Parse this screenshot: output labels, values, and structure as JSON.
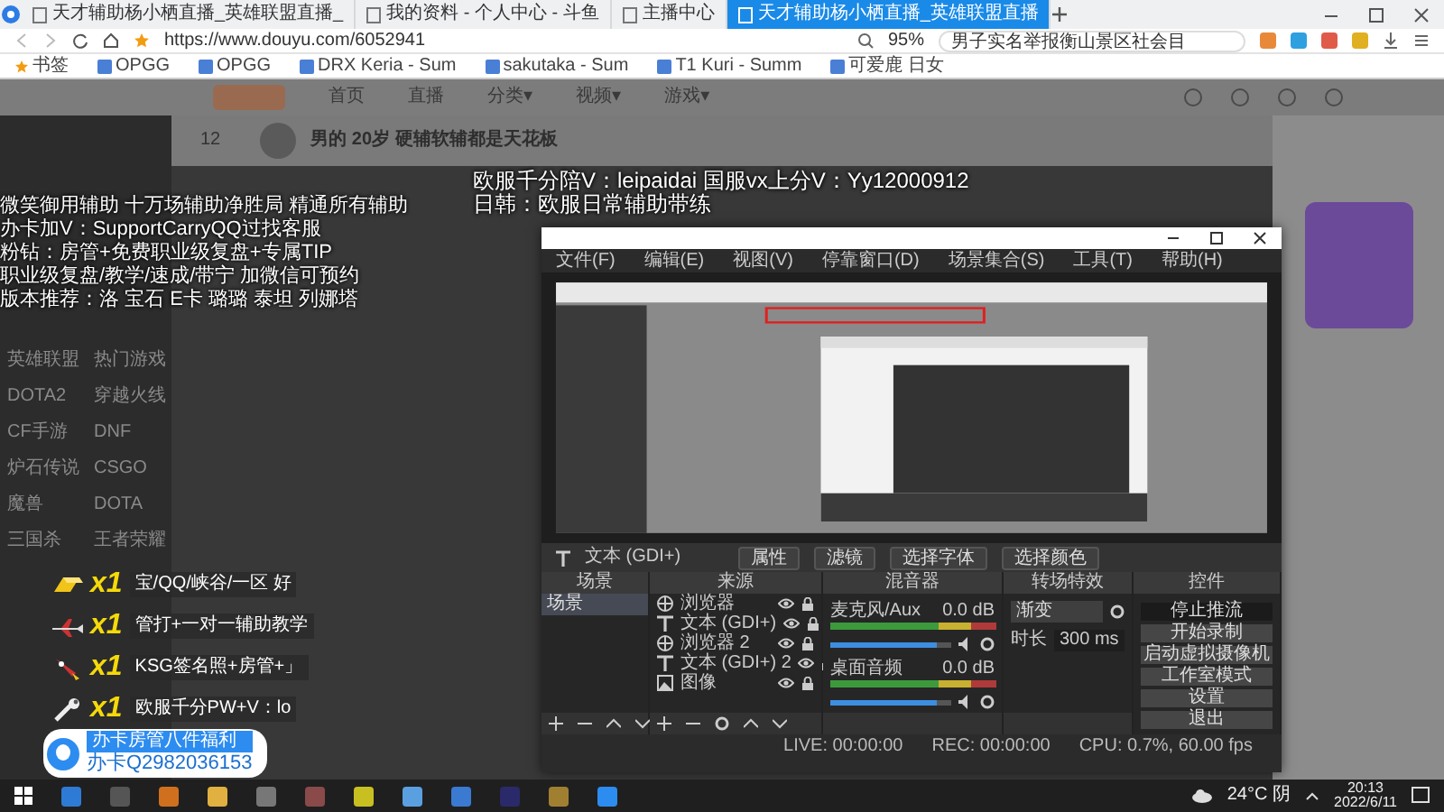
{
  "browser": {
    "tabs": [
      {
        "title": "天才辅助杨小栖直播_英雄联盟直播_",
        "selected": false
      },
      {
        "title": "我的资料 - 个人中心 - 斗鱼",
        "selected": false
      },
      {
        "title": "主播中心",
        "selected": false
      },
      {
        "title": "天才辅助杨小栖直播_英雄联盟直播",
        "selected": true
      }
    ],
    "url": "https://www.douyu.com/6052941",
    "zoom": "95%",
    "search": "男子实名举报衡山景区社会目",
    "bookmarks": [
      "书签",
      "OPGG",
      "OPGG",
      "DRX Keria - Sum",
      "sakutaka - Sum",
      "T1 Kuri - Summ",
      "可爱鹿 日女"
    ]
  },
  "page": {
    "nav": [
      "首页",
      "直播",
      "分类▾",
      "视频▾",
      "游戏▾"
    ],
    "sidebar_categories": [
      "英雄联盟",
      "热门游戏",
      "DOTA2",
      "穿越火线",
      "CF手游",
      "DNF",
      "炉石传说",
      "CSGO",
      "魔兽",
      "DOTA",
      "三国杀",
      "王者荣耀"
    ],
    "streamer": {
      "title": "男的 20岁 硬辅软辅都是天花板",
      "stat": "12"
    }
  },
  "overlay": {
    "banner": [
      "欧服千分陪V：leipaidai 国服vx上分V：Yy12000912",
      "日韩：欧服日常辅助带练"
    ],
    "notes": [
      "微笑御用辅助 十万场辅助净胜局 精通所有辅助",
      "办卡加V：SupportCarryQQ过找客服",
      "粉钻：房管+免费职业级复盘+专属TIP",
      "职业级复盘/教学/速成/带宁 加微信可预约",
      "版本推荐：洛 宝石 E卡 璐璐 泰坦 列娜塔"
    ],
    "gifts": [
      {
        "kind": "bar",
        "count": "x1",
        "text": "宝/QQ/峡谷/一区 好"
      },
      {
        "kind": "plane",
        "count": "x1",
        "text": "管打+一对一辅助教学"
      },
      {
        "kind": "rocket",
        "count": "x1",
        "text": "KSG签名照+房管+」"
      },
      {
        "kind": "wrench",
        "count": "x1",
        "text": "欧服千分PW+V：lo"
      }
    ],
    "qq_card": {
      "label": "办卡房管八件福利",
      "number": "办卡Q2982036153"
    }
  },
  "obs": {
    "menu": [
      "文件(F)",
      "编辑(E)",
      "视图(V)",
      "停靠窗口(D)",
      "场景集合(S)",
      "工具(T)",
      "帮助(H)"
    ],
    "source_name": "文本 (GDI+)",
    "toolbar_buttons": [
      "属性",
      "滤镜",
      "选择字体",
      "选择颜色"
    ],
    "docks": [
      "场景",
      "来源",
      "混音器",
      "转场特效",
      "控件"
    ],
    "scenes": [
      {
        "name": "场景",
        "selected": true
      }
    ],
    "sources": [
      {
        "kind": "browser",
        "name": "浏览器"
      },
      {
        "kind": "text",
        "name": "文本 (GDI+)"
      },
      {
        "kind": "browser",
        "name": "浏览器 2"
      },
      {
        "kind": "text",
        "name": "文本 (GDI+) 2"
      },
      {
        "kind": "image",
        "name": "图像"
      }
    ],
    "mixer": [
      {
        "name": "麦克风/Aux",
        "reading": "0.0 dB",
        "level": 0.88
      },
      {
        "name": "桌面音频",
        "reading": "0.0 dB",
        "level": 0.88
      }
    ],
    "transition": {
      "value": "渐变",
      "duration_label": "时长",
      "duration": "300 ms"
    },
    "controls": [
      "停止推流",
      "开始录制",
      "启动虚拟摄像机",
      "工作室模式",
      "设置",
      "退出"
    ],
    "status": {
      "live": "LIVE: 00:00:00",
      "rec": "REC: 00:00:00",
      "cpu": "CPU: 0.7%, 60.00 fps"
    }
  },
  "taskbar": {
    "weather": "24°C 阴",
    "time": "20:13",
    "date": "2022/6/11"
  }
}
